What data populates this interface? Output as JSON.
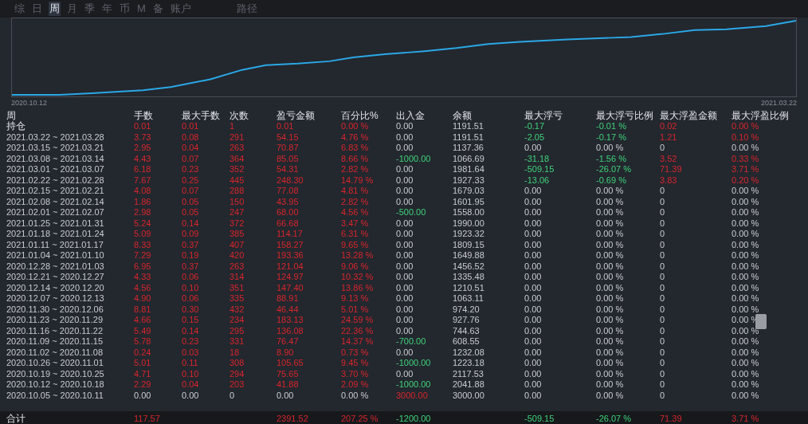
{
  "tabs": [
    {
      "label": "综",
      "selected": false
    },
    {
      "label": "日",
      "selected": false
    },
    {
      "label": "周",
      "selected": true
    },
    {
      "label": "月",
      "selected": false
    },
    {
      "label": "季",
      "selected": false
    },
    {
      "label": "年",
      "selected": false
    },
    {
      "label": "币",
      "selected": false
    },
    {
      "label": "M",
      "selected": false
    },
    {
      "label": "备",
      "selected": false
    },
    {
      "label": "账户",
      "selected": false
    },
    {
      "label": "路径",
      "selected": false
    }
  ],
  "chart": {
    "start_label": "2020.10.12",
    "end_label": "2021.03.22"
  },
  "table": {
    "columns": [
      "周",
      "手数",
      "最大手数",
      "次数",
      "盈亏金额",
      "百分比%",
      "出入金",
      "余额",
      "最大浮亏",
      "最大浮亏比例",
      "最大浮盈金额",
      "最大浮盈比例"
    ],
    "rows": [
      [
        {
          "text": "持仓",
          "positive": false,
          "negative": false
        },
        {
          "text": "0.01",
          "positive": true,
          "negative": false
        },
        {
          "text": "0.01",
          "positive": true,
          "negative": false
        },
        {
          "text": "1",
          "positive": true,
          "negative": false
        },
        {
          "text": "0.01",
          "positive": true,
          "negative": false
        },
        {
          "text": "0.00 %",
          "positive": true,
          "negative": false
        },
        {
          "text": "0.00",
          "positive": false,
          "negative": false
        },
        {
          "text": "1191.51",
          "positive": false,
          "negative": false
        },
        {
          "text": "-0.17",
          "positive": false,
          "negative": true
        },
        {
          "text": "-0.01 %",
          "positive": false,
          "negative": true
        },
        {
          "text": "0.02",
          "positive": true,
          "negative": false
        },
        {
          "text": "0.00 %",
          "positive": true,
          "negative": false
        }
      ],
      [
        {
          "text": "2021.03.22 ~ 2021.03.28",
          "positive": false,
          "negative": false
        },
        {
          "text": "3.73",
          "positive": true,
          "negative": false
        },
        {
          "text": "0.08",
          "positive": true,
          "negative": false
        },
        {
          "text": "291",
          "positive": true,
          "negative": false
        },
        {
          "text": "54.15",
          "positive": true,
          "negative": false
        },
        {
          "text": "4.76 %",
          "positive": true,
          "negative": false
        },
        {
          "text": "0.00",
          "positive": false,
          "negative": false
        },
        {
          "text": "1191.51",
          "positive": false,
          "negative": false
        },
        {
          "text": "-2.05",
          "positive": false,
          "negative": true
        },
        {
          "text": "-0.17 %",
          "positive": false,
          "negative": true
        },
        {
          "text": "1.21",
          "positive": true,
          "negative": false
        },
        {
          "text": "0.10 %",
          "positive": true,
          "negative": false
        }
      ],
      [
        {
          "text": "2021.03.15 ~ 2021.03.21",
          "positive": false,
          "negative": false
        },
        {
          "text": "2.95",
          "positive": true,
          "negative": false
        },
        {
          "text": "0.04",
          "positive": true,
          "negative": false
        },
        {
          "text": "263",
          "positive": true,
          "negative": false
        },
        {
          "text": "70.87",
          "positive": true,
          "negative": false
        },
        {
          "text": "6.83 %",
          "positive": true,
          "negative": false
        },
        {
          "text": "0.00",
          "positive": false,
          "negative": false
        },
        {
          "text": "1137.36",
          "positive": false,
          "negative": false
        },
        {
          "text": "0.00",
          "positive": false,
          "negative": false
        },
        {
          "text": "0.00 %",
          "positive": false,
          "negative": false
        },
        {
          "text": "0",
          "positive": false,
          "negative": false
        },
        {
          "text": "0.00 %",
          "positive": false,
          "negative": false
        }
      ],
      [
        {
          "text": "2021.03.08 ~ 2021.03.14",
          "positive": false,
          "negative": false
        },
        {
          "text": "4.43",
          "positive": true,
          "negative": false
        },
        {
          "text": "0.07",
          "positive": true,
          "negative": false
        },
        {
          "text": "364",
          "positive": true,
          "negative": false
        },
        {
          "text": "85.05",
          "positive": true,
          "negative": false
        },
        {
          "text": "8.66 %",
          "positive": true,
          "negative": false
        },
        {
          "text": "-1000.00",
          "positive": false,
          "negative": true
        },
        {
          "text": "1066.69",
          "positive": false,
          "negative": false
        },
        {
          "text": "-31.18",
          "positive": false,
          "negative": true
        },
        {
          "text": "-1.56 %",
          "positive": false,
          "negative": true
        },
        {
          "text": "3.52",
          "positive": true,
          "negative": false
        },
        {
          "text": "0.33 %",
          "positive": true,
          "negative": false
        }
      ],
      [
        {
          "text": "2021.03.01 ~ 2021.03.07",
          "positive": false,
          "negative": false
        },
        {
          "text": "6.18",
          "positive": true,
          "negative": false
        },
        {
          "text": "0.23",
          "positive": true,
          "negative": false
        },
        {
          "text": "352",
          "positive": true,
          "negative": false
        },
        {
          "text": "54.31",
          "positive": true,
          "negative": false
        },
        {
          "text": "2.82 %",
          "positive": true,
          "negative": false
        },
        {
          "text": "0.00",
          "positive": false,
          "negative": false
        },
        {
          "text": "1981.64",
          "positive": false,
          "negative": false
        },
        {
          "text": "-509.15",
          "positive": false,
          "negative": true
        },
        {
          "text": "-26.07 %",
          "positive": false,
          "negative": true
        },
        {
          "text": "71.39",
          "positive": true,
          "negative": false
        },
        {
          "text": "3.71 %",
          "positive": true,
          "negative": false
        }
      ],
      [
        {
          "text": "2021.02.22 ~ 2021.02.28",
          "positive": false,
          "negative": false
        },
        {
          "text": "7.67",
          "positive": true,
          "negative": false
        },
        {
          "text": "0.25",
          "positive": true,
          "negative": false
        },
        {
          "text": "445",
          "positive": true,
          "negative": false
        },
        {
          "text": "248.30",
          "positive": true,
          "negative": false
        },
        {
          "text": "14.79 %",
          "positive": true,
          "negative": false
        },
        {
          "text": "0.00",
          "positive": false,
          "negative": false
        },
        {
          "text": "1927.33",
          "positive": false,
          "negative": false
        },
        {
          "text": "-13.06",
          "positive": false,
          "negative": true
        },
        {
          "text": "-0.69 %",
          "positive": false,
          "negative": true
        },
        {
          "text": "3.83",
          "positive": true,
          "negative": false
        },
        {
          "text": "0.20 %",
          "positive": true,
          "negative": false
        }
      ],
      [
        {
          "text": "2021.02.15 ~ 2021.02.21",
          "positive": false,
          "negative": false
        },
        {
          "text": "4.08",
          "positive": true,
          "negative": false
        },
        {
          "text": "0.07",
          "positive": true,
          "negative": false
        },
        {
          "text": "288",
          "positive": true,
          "negative": false
        },
        {
          "text": "77.08",
          "positive": true,
          "negative": false
        },
        {
          "text": "4.81 %",
          "positive": true,
          "negative": false
        },
        {
          "text": "0.00",
          "positive": false,
          "negative": false
        },
        {
          "text": "1679.03",
          "positive": false,
          "negative": false
        },
        {
          "text": "0.00",
          "positive": false,
          "negative": false
        },
        {
          "text": "0.00 %",
          "positive": false,
          "negative": false
        },
        {
          "text": "0",
          "positive": false,
          "negative": false
        },
        {
          "text": "0.00 %",
          "positive": false,
          "negative": false
        }
      ],
      [
        {
          "text": "2021.02.08 ~ 2021.02.14",
          "positive": false,
          "negative": false
        },
        {
          "text": "1.86",
          "positive": true,
          "negative": false
        },
        {
          "text": "0.05",
          "positive": true,
          "negative": false
        },
        {
          "text": "150",
          "positive": true,
          "negative": false
        },
        {
          "text": "43.95",
          "positive": true,
          "negative": false
        },
        {
          "text": "2.82 %",
          "positive": true,
          "negative": false
        },
        {
          "text": "0.00",
          "positive": false,
          "negative": false
        },
        {
          "text": "1601.95",
          "positive": false,
          "negative": false
        },
        {
          "text": "0.00",
          "positive": false,
          "negative": false
        },
        {
          "text": "0.00 %",
          "positive": false,
          "negative": false
        },
        {
          "text": "0",
          "positive": false,
          "negative": false
        },
        {
          "text": "0.00 %",
          "positive": false,
          "negative": false
        }
      ],
      [
        {
          "text": "2021.02.01 ~ 2021.02.07",
          "positive": false,
          "negative": false
        },
        {
          "text": "2.98",
          "positive": true,
          "negative": false
        },
        {
          "text": "0.05",
          "positive": true,
          "negative": false
        },
        {
          "text": "247",
          "positive": true,
          "negative": false
        },
        {
          "text": "68.00",
          "positive": true,
          "negative": false
        },
        {
          "text": "4.56 %",
          "positive": true,
          "negative": false
        },
        {
          "text": "-500.00",
          "positive": false,
          "negative": true
        },
        {
          "text": "1558.00",
          "positive": false,
          "negative": false
        },
        {
          "text": "0.00",
          "positive": false,
          "negative": false
        },
        {
          "text": "0.00 %",
          "positive": false,
          "negative": false
        },
        {
          "text": "0",
          "positive": false,
          "negative": false
        },
        {
          "text": "0.00 %",
          "positive": false,
          "negative": false
        }
      ],
      [
        {
          "text": "2021.01.25 ~ 2021.01.31",
          "positive": false,
          "negative": false
        },
        {
          "text": "5.24",
          "positive": true,
          "negative": false
        },
        {
          "text": "0.14",
          "positive": true,
          "negative": false
        },
        {
          "text": "372",
          "positive": true,
          "negative": false
        },
        {
          "text": "66.68",
          "positive": true,
          "negative": false
        },
        {
          "text": "3.47 %",
          "positive": true,
          "negative": false
        },
        {
          "text": "0.00",
          "positive": false,
          "negative": false
        },
        {
          "text": "1990.00",
          "positive": false,
          "negative": false
        },
        {
          "text": "0.00",
          "positive": false,
          "negative": false
        },
        {
          "text": "0.00 %",
          "positive": false,
          "negative": false
        },
        {
          "text": "0",
          "positive": false,
          "negative": false
        },
        {
          "text": "0.00 %",
          "positive": false,
          "negative": false
        }
      ],
      [
        {
          "text": "2021.01.18 ~ 2021.01.24",
          "positive": false,
          "negative": false
        },
        {
          "text": "5.09",
          "positive": true,
          "negative": false
        },
        {
          "text": "0.09",
          "positive": true,
          "negative": false
        },
        {
          "text": "385",
          "positive": true,
          "negative": false
        },
        {
          "text": "114.17",
          "positive": true,
          "negative": false
        },
        {
          "text": "6.31 %",
          "positive": true,
          "negative": false
        },
        {
          "text": "0.00",
          "positive": false,
          "negative": false
        },
        {
          "text": "1923.32",
          "positive": false,
          "negative": false
        },
        {
          "text": "0.00",
          "positive": false,
          "negative": false
        },
        {
          "text": "0.00 %",
          "positive": false,
          "negative": false
        },
        {
          "text": "0",
          "positive": false,
          "negative": false
        },
        {
          "text": "0.00 %",
          "positive": false,
          "negative": false
        }
      ],
      [
        {
          "text": "2021.01.11 ~ 2021.01.17",
          "positive": false,
          "negative": false
        },
        {
          "text": "8.33",
          "positive": true,
          "negative": false
        },
        {
          "text": "0.37",
          "positive": true,
          "negative": false
        },
        {
          "text": "407",
          "positive": true,
          "negative": false
        },
        {
          "text": "158.27",
          "positive": true,
          "negative": false
        },
        {
          "text": "9.65 %",
          "positive": true,
          "negative": false
        },
        {
          "text": "0.00",
          "positive": false,
          "negative": false
        },
        {
          "text": "1809.15",
          "positive": false,
          "negative": false
        },
        {
          "text": "0.00",
          "positive": false,
          "negative": false
        },
        {
          "text": "0.00 %",
          "positive": false,
          "negative": false
        },
        {
          "text": "0",
          "positive": false,
          "negative": false
        },
        {
          "text": "0.00 %",
          "positive": false,
          "negative": false
        }
      ],
      [
        {
          "text": "2021.01.04 ~ 2021.01.10",
          "positive": false,
          "negative": false
        },
        {
          "text": "7.29",
          "positive": true,
          "negative": false
        },
        {
          "text": "0.19",
          "positive": true,
          "negative": false
        },
        {
          "text": "420",
          "positive": true,
          "negative": false
        },
        {
          "text": "193.36",
          "positive": true,
          "negative": false
        },
        {
          "text": "13.28 %",
          "positive": true,
          "negative": false
        },
        {
          "text": "0.00",
          "positive": false,
          "negative": false
        },
        {
          "text": "1649.88",
          "positive": false,
          "negative": false
        },
        {
          "text": "0.00",
          "positive": false,
          "negative": false
        },
        {
          "text": "0.00 %",
          "positive": false,
          "negative": false
        },
        {
          "text": "0",
          "positive": false,
          "negative": false
        },
        {
          "text": "0.00 %",
          "positive": false,
          "negative": false
        }
      ],
      [
        {
          "text": "2020.12.28 ~ 2021.01.03",
          "positive": false,
          "negative": false
        },
        {
          "text": "6.95",
          "positive": true,
          "negative": false
        },
        {
          "text": "0.37",
          "positive": true,
          "negative": false
        },
        {
          "text": "263",
          "positive": true,
          "negative": false
        },
        {
          "text": "121.04",
          "positive": true,
          "negative": false
        },
        {
          "text": "9.06 %",
          "positive": true,
          "negative": false
        },
        {
          "text": "0.00",
          "positive": false,
          "negative": false
        },
        {
          "text": "1456.52",
          "positive": false,
          "negative": false
        },
        {
          "text": "0.00",
          "positive": false,
          "negative": false
        },
        {
          "text": "0.00 %",
          "positive": false,
          "negative": false
        },
        {
          "text": "0",
          "positive": false,
          "negative": false
        },
        {
          "text": "0.00 %",
          "positive": false,
          "negative": false
        }
      ],
      [
        {
          "text": "2020.12.21 ~ 2020.12.27",
          "positive": false,
          "negative": false
        },
        {
          "text": "4.33",
          "positive": true,
          "negative": false
        },
        {
          "text": "0.06",
          "positive": true,
          "negative": false
        },
        {
          "text": "314",
          "positive": true,
          "negative": false
        },
        {
          "text": "124.97",
          "positive": true,
          "negative": false
        },
        {
          "text": "10.32 %",
          "positive": true,
          "negative": false
        },
        {
          "text": "0.00",
          "positive": false,
          "negative": false
        },
        {
          "text": "1335.48",
          "positive": false,
          "negative": false
        },
        {
          "text": "0.00",
          "positive": false,
          "negative": false
        },
        {
          "text": "0.00 %",
          "positive": false,
          "negative": false
        },
        {
          "text": "0",
          "positive": false,
          "negative": false
        },
        {
          "text": "0.00 %",
          "positive": false,
          "negative": false
        }
      ],
      [
        {
          "text": "2020.12.14 ~ 2020.12.20",
          "positive": false,
          "negative": false
        },
        {
          "text": "4.56",
          "positive": true,
          "negative": false
        },
        {
          "text": "0.10",
          "positive": true,
          "negative": false
        },
        {
          "text": "351",
          "positive": true,
          "negative": false
        },
        {
          "text": "147.40",
          "positive": true,
          "negative": false
        },
        {
          "text": "13.86 %",
          "positive": true,
          "negative": false
        },
        {
          "text": "0.00",
          "positive": false,
          "negative": false
        },
        {
          "text": "1210.51",
          "positive": false,
          "negative": false
        },
        {
          "text": "0.00",
          "positive": false,
          "negative": false
        },
        {
          "text": "0.00 %",
          "positive": false,
          "negative": false
        },
        {
          "text": "0",
          "positive": false,
          "negative": false
        },
        {
          "text": "0.00 %",
          "positive": false,
          "negative": false
        }
      ],
      [
        {
          "text": "2020.12.07 ~ 2020.12.13",
          "positive": false,
          "negative": false
        },
        {
          "text": "4.90",
          "positive": true,
          "negative": false
        },
        {
          "text": "0.06",
          "positive": true,
          "negative": false
        },
        {
          "text": "335",
          "positive": true,
          "negative": false
        },
        {
          "text": "88.91",
          "positive": true,
          "negative": false
        },
        {
          "text": "9.13 %",
          "positive": true,
          "negative": false
        },
        {
          "text": "0.00",
          "positive": false,
          "negative": false
        },
        {
          "text": "1063.11",
          "positive": false,
          "negative": false
        },
        {
          "text": "0.00",
          "positive": false,
          "negative": false
        },
        {
          "text": "0.00 %",
          "positive": false,
          "negative": false
        },
        {
          "text": "0",
          "positive": false,
          "negative": false
        },
        {
          "text": "0.00 %",
          "positive": false,
          "negative": false
        }
      ],
      [
        {
          "text": "2020.11.30 ~ 2020.12.06",
          "positive": false,
          "negative": false
        },
        {
          "text": "8.81",
          "positive": true,
          "negative": false
        },
        {
          "text": "0.30",
          "positive": true,
          "negative": false
        },
        {
          "text": "432",
          "positive": true,
          "negative": false
        },
        {
          "text": "46.44",
          "positive": true,
          "negative": false
        },
        {
          "text": "5.01 %",
          "positive": true,
          "negative": false
        },
        {
          "text": "0.00",
          "positive": false,
          "negative": false
        },
        {
          "text": "974.20",
          "positive": false,
          "negative": false
        },
        {
          "text": "0.00",
          "positive": false,
          "negative": false
        },
        {
          "text": "0.00 %",
          "positive": false,
          "negative": false
        },
        {
          "text": "0",
          "positive": false,
          "negative": false
        },
        {
          "text": "0.00 %",
          "positive": false,
          "negative": false
        }
      ],
      [
        {
          "text": "2020.11.23 ~ 2020.11.29",
          "positive": false,
          "negative": false
        },
        {
          "text": "4.66",
          "positive": true,
          "negative": false
        },
        {
          "text": "0.15",
          "positive": true,
          "negative": false
        },
        {
          "text": "234",
          "positive": true,
          "negative": false
        },
        {
          "text": "183.13",
          "positive": true,
          "negative": false
        },
        {
          "text": "24.59 %",
          "positive": true,
          "negative": false
        },
        {
          "text": "0.00",
          "positive": false,
          "negative": false
        },
        {
          "text": "927.76",
          "positive": false,
          "negative": false
        },
        {
          "text": "0.00",
          "positive": false,
          "negative": false
        },
        {
          "text": "0.00 %",
          "positive": false,
          "negative": false
        },
        {
          "text": "0",
          "positive": false,
          "negative": false
        },
        {
          "text": "0.00 %",
          "positive": false,
          "negative": false
        }
      ],
      [
        {
          "text": "2020.11.16 ~ 2020.11.22",
          "positive": false,
          "negative": false
        },
        {
          "text": "5.49",
          "positive": true,
          "negative": false
        },
        {
          "text": "0.14",
          "positive": true,
          "negative": false
        },
        {
          "text": "295",
          "positive": true,
          "negative": false
        },
        {
          "text": "136.08",
          "positive": true,
          "negative": false
        },
        {
          "text": "22.36 %",
          "positive": true,
          "negative": false
        },
        {
          "text": "0.00",
          "positive": false,
          "negative": false
        },
        {
          "text": "744.63",
          "positive": false,
          "negative": false
        },
        {
          "text": "0.00",
          "positive": false,
          "negative": false
        },
        {
          "text": "0.00 %",
          "positive": false,
          "negative": false
        },
        {
          "text": "0",
          "positive": false,
          "negative": false
        },
        {
          "text": "0.00 %",
          "positive": false,
          "negative": false
        }
      ],
      [
        {
          "text": "2020.11.09 ~ 2020.11.15",
          "positive": false,
          "negative": false
        },
        {
          "text": "5.78",
          "positive": true,
          "negative": false
        },
        {
          "text": "0.23",
          "positive": true,
          "negative": false
        },
        {
          "text": "331",
          "positive": true,
          "negative": false
        },
        {
          "text": "76.47",
          "positive": true,
          "negative": false
        },
        {
          "text": "14.37 %",
          "positive": true,
          "negative": false
        },
        {
          "text": "-700.00",
          "positive": false,
          "negative": true
        },
        {
          "text": "608.55",
          "positive": false,
          "negative": false
        },
        {
          "text": "0.00",
          "positive": false,
          "negative": false
        },
        {
          "text": "0.00 %",
          "positive": false,
          "negative": false
        },
        {
          "text": "0",
          "positive": false,
          "negative": false
        },
        {
          "text": "0.00 %",
          "positive": false,
          "negative": false
        }
      ],
      [
        {
          "text": "2020.11.02 ~ 2020.11.08",
          "positive": false,
          "negative": false
        },
        {
          "text": "0.24",
          "positive": true,
          "negative": false
        },
        {
          "text": "0.03",
          "positive": true,
          "negative": false
        },
        {
          "text": "18",
          "positive": true,
          "negative": false
        },
        {
          "text": "8.90",
          "positive": true,
          "negative": false
        },
        {
          "text": "0.73 %",
          "positive": true,
          "negative": false
        },
        {
          "text": "0.00",
          "positive": false,
          "negative": false
        },
        {
          "text": "1232.08",
          "positive": false,
          "negative": false
        },
        {
          "text": "0.00",
          "positive": false,
          "negative": false
        },
        {
          "text": "0.00 %",
          "positive": false,
          "negative": false
        },
        {
          "text": "0",
          "positive": false,
          "negative": false
        },
        {
          "text": "0.00 %",
          "positive": false,
          "negative": false
        }
      ],
      [
        {
          "text": "2020.10.26 ~ 2020.11.01",
          "positive": false,
          "negative": false
        },
        {
          "text": "5.01",
          "positive": true,
          "negative": false
        },
        {
          "text": "0.11",
          "positive": true,
          "negative": false
        },
        {
          "text": "308",
          "positive": true,
          "negative": false
        },
        {
          "text": "105.65",
          "positive": true,
          "negative": false
        },
        {
          "text": "9.45 %",
          "positive": true,
          "negative": false
        },
        {
          "text": "-1000.00",
          "positive": false,
          "negative": true
        },
        {
          "text": "1223.18",
          "positive": false,
          "negative": false
        },
        {
          "text": "0.00",
          "positive": false,
          "negative": false
        },
        {
          "text": "0.00 %",
          "positive": false,
          "negative": false
        },
        {
          "text": "0",
          "positive": false,
          "negative": false
        },
        {
          "text": "0.00 %",
          "positive": false,
          "negative": false
        }
      ],
      [
        {
          "text": "2020.10.19 ~ 2020.10.25",
          "positive": false,
          "negative": false
        },
        {
          "text": "4.71",
          "positive": true,
          "negative": false
        },
        {
          "text": "0.10",
          "positive": true,
          "negative": false
        },
        {
          "text": "294",
          "positive": true,
          "negative": false
        },
        {
          "text": "75.65",
          "positive": true,
          "negative": false
        },
        {
          "text": "3.70 %",
          "positive": true,
          "negative": false
        },
        {
          "text": "0.00",
          "positive": false,
          "negative": false
        },
        {
          "text": "2117.53",
          "positive": false,
          "negative": false
        },
        {
          "text": "0.00",
          "positive": false,
          "negative": false
        },
        {
          "text": "0.00 %",
          "positive": false,
          "negative": false
        },
        {
          "text": "0",
          "positive": false,
          "negative": false
        },
        {
          "text": "0.00 %",
          "positive": false,
          "negative": false
        }
      ],
      [
        {
          "text": "2020.10.12 ~ 2020.10.18",
          "positive": false,
          "negative": false
        },
        {
          "text": "2.29",
          "positive": true,
          "negative": false
        },
        {
          "text": "0.04",
          "positive": true,
          "negative": false
        },
        {
          "text": "203",
          "positive": true,
          "negative": false
        },
        {
          "text": "41.88",
          "positive": true,
          "negative": false
        },
        {
          "text": "2.09 %",
          "positive": true,
          "negative": false
        },
        {
          "text": "-1000.00",
          "positive": false,
          "negative": true
        },
        {
          "text": "2041.88",
          "positive": false,
          "negative": false
        },
        {
          "text": "0.00",
          "positive": false,
          "negative": false
        },
        {
          "text": "0.00 %",
          "positive": false,
          "negative": false
        },
        {
          "text": "0",
          "positive": false,
          "negative": false
        },
        {
          "text": "0.00 %",
          "positive": false,
          "negative": false
        }
      ],
      [
        {
          "text": "2020.10.05 ~ 2020.10.11",
          "positive": false,
          "negative": false
        },
        {
          "text": "0.00",
          "positive": false,
          "negative": false
        },
        {
          "text": "0.00",
          "positive": false,
          "negative": false
        },
        {
          "text": "0",
          "positive": false,
          "negative": false
        },
        {
          "text": "0.00",
          "positive": false,
          "negative": false
        },
        {
          "text": "0.00 %",
          "positive": false,
          "negative": false
        },
        {
          "text": "3000.00",
          "positive": true,
          "negative": false
        },
        {
          "text": "3000.00",
          "positive": false,
          "negative": false
        },
        {
          "text": "0.00",
          "positive": false,
          "negative": false
        },
        {
          "text": "0.00 %",
          "positive": false,
          "negative": false
        },
        {
          "text": "0",
          "positive": false,
          "negative": false
        },
        {
          "text": "0.00 %",
          "positive": false,
          "negative": false
        }
      ]
    ],
    "total": {
      "label": {
        "text": "合计",
        "positive": false,
        "negative": false
      },
      "lots": {
        "text": "117.57",
        "positive": true,
        "negative": false
      },
      "profit": {
        "text": "2391.52",
        "positive": true,
        "negative": false
      },
      "percent": {
        "text": "207.25 %",
        "positive": true,
        "negative": false
      },
      "deposit": {
        "text": "-1200.00",
        "positive": false,
        "negative": true
      },
      "max_float_loss": {
        "text": "-509.15",
        "positive": false,
        "negative": true
      },
      "max_float_loss_ratio": {
        "text": "-26.07 %",
        "positive": false,
        "negative": true
      },
      "max_float_profit": {
        "text": "71.39",
        "positive": true,
        "negative": false
      },
      "max_float_profit_ratio": {
        "text": "3.71 %",
        "positive": true,
        "negative": false
      }
    }
  }
}
